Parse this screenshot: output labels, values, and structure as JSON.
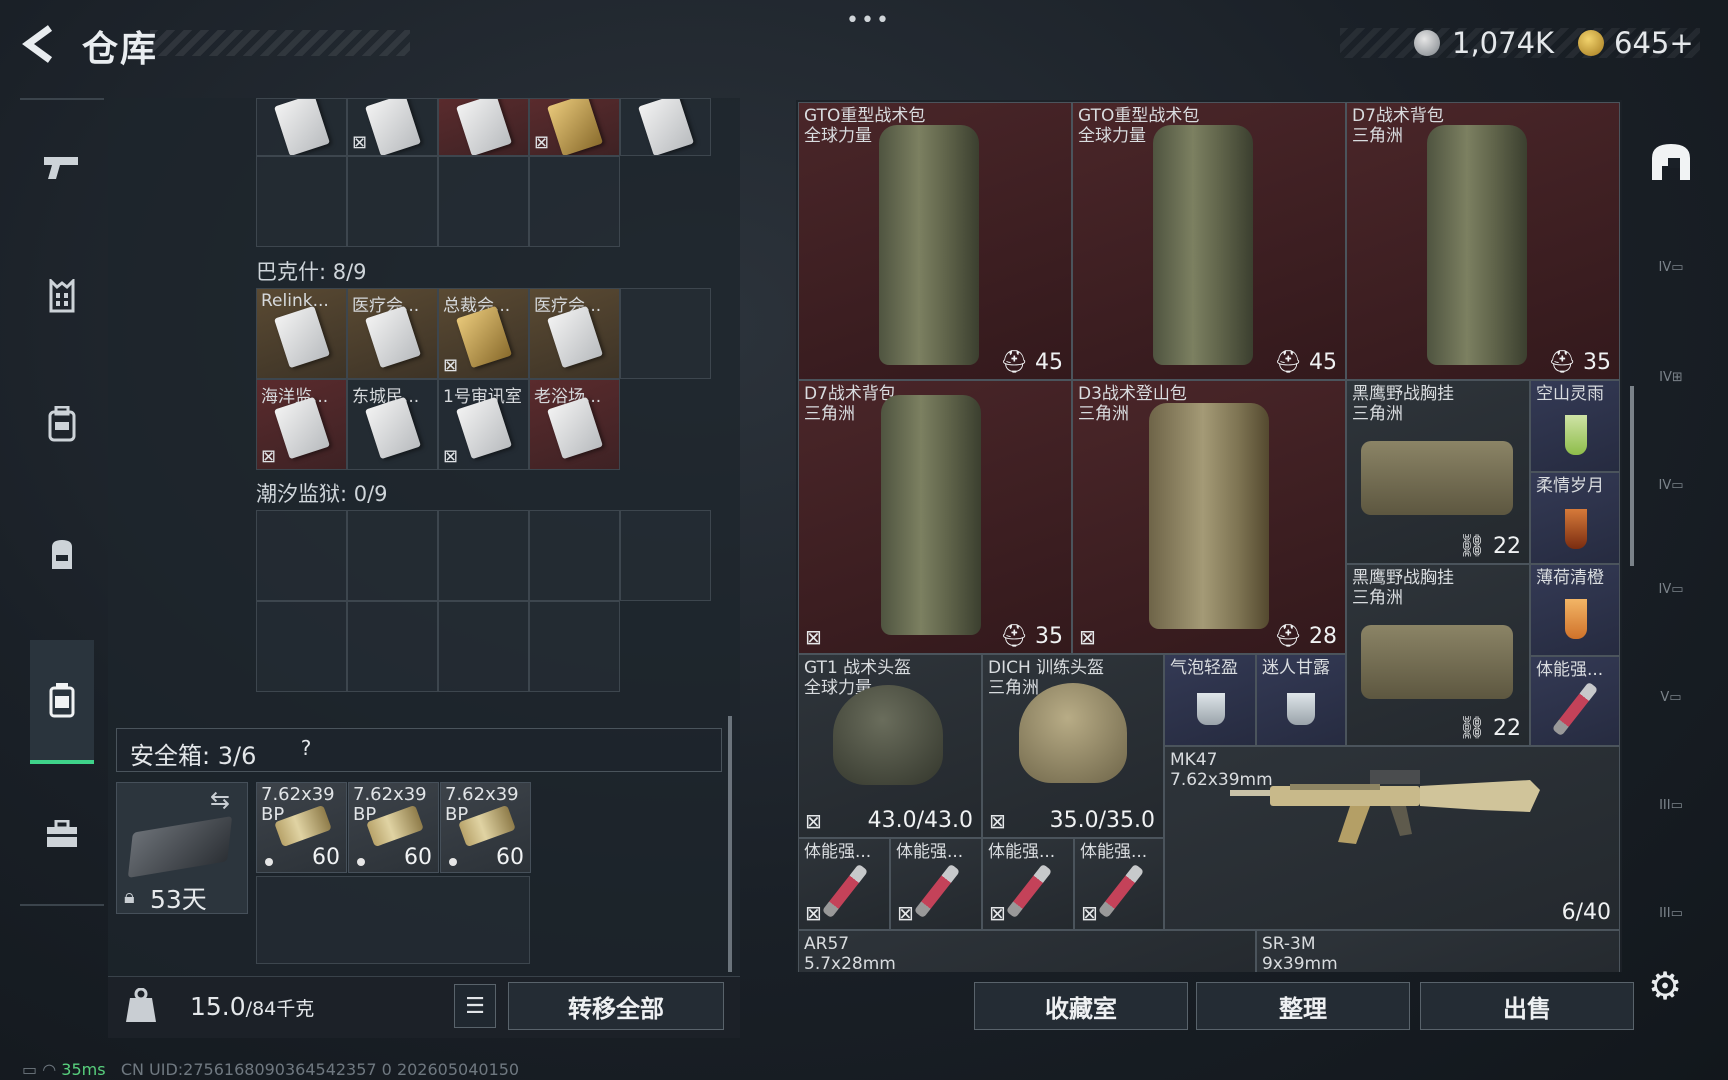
{
  "header": {
    "title": "仓库",
    "menu_dots": "•••",
    "currency_amount": "1,074K",
    "token_amount": "645+"
  },
  "sidebar": {
    "items": [
      {
        "icon": "pistol-icon"
      },
      {
        "icon": "vest-icon"
      },
      {
        "icon": "armor-icon"
      },
      {
        "icon": "backpack-icon"
      },
      {
        "icon": "storage-case-icon",
        "active": true
      },
      {
        "icon": "briefcase-icon"
      }
    ]
  },
  "left_panel": {
    "bakesh_title": "巴克什: 8/9",
    "bakesh_row1": [
      "Relink...",
      "医疗会...",
      "总裁会...",
      "医疗会..."
    ],
    "bakesh_row2": [
      "海洋监...",
      "东城民...",
      "1号审讯室",
      "老浴场..."
    ],
    "tidal_title": "潮汐监狱: 0/9",
    "safe_title": "安全箱: 3/6",
    "safe_help": "?",
    "safe_days": "53天",
    "ammo": [
      {
        "line1": "7.62x39",
        "line2": "BP",
        "count": "60"
      },
      {
        "line1": "7.62x39",
        "line2": "BP",
        "count": "60"
      },
      {
        "line1": "7.62x39",
        "line2": "BP",
        "count": "60"
      }
    ],
    "weight_value": "15.0",
    "weight_total": "/84千克",
    "transfer_all": "转移全部"
  },
  "stash": {
    "tiles": {
      "bp1": {
        "name": "GTO重型战术包",
        "sub": "全球力量",
        "qty": "45"
      },
      "bp2": {
        "name": "GTO重型战术包",
        "sub": "全球力量",
        "qty": "45"
      },
      "bp3": {
        "name": "D7战术背包",
        "sub": "三角洲",
        "qty": "35"
      },
      "bp4": {
        "name": "D7战术背包",
        "sub": "三角洲",
        "qty": "35"
      },
      "bp5": {
        "name": "D3战术登山包",
        "sub": "三角洲",
        "qty": "28"
      },
      "vest1": {
        "name": "黑鹰野战胸挂",
        "sub": "三角洲",
        "qty": "22"
      },
      "vest2": {
        "name": "黑鹰野战胸挂",
        "sub": "三角洲",
        "qty": "22"
      },
      "drink1": {
        "name": "空山灵雨"
      },
      "drink2": {
        "name": "柔情岁月"
      },
      "drink3": {
        "name": "薄荷清橙"
      },
      "syr_side": {
        "name": "体能强..."
      },
      "helm1": {
        "name": "GT1 战术头盔",
        "sub": "全球力量",
        "qty": "43.0/43.0"
      },
      "helm2": {
        "name": "DICH 训练头盔",
        "sub": "三角洲",
        "qty": "35.0/35.0"
      },
      "small1": {
        "name": "气泡轻盈"
      },
      "small2": {
        "name": "迷人甘露"
      },
      "rifle": {
        "name": "MK47",
        "sub": "7.62x39mm",
        "qty": "6/40"
      },
      "syr": [
        "体能强...",
        "体能强...",
        "体能强...",
        "体能强..."
      ],
      "ar57": {
        "name": "AR57",
        "sub": "5.7x28mm"
      },
      "sr3m": {
        "name": "SR-3M",
        "sub": "9x39mm"
      }
    }
  },
  "right_sidebar": {
    "tier_labels": [
      "IV",
      "IV",
      "IV",
      "IV",
      "V",
      "III",
      "III"
    ]
  },
  "buttons": {
    "collection": "收藏室",
    "organize": "整理",
    "sell": "出售"
  },
  "status_bar": {
    "ping": "35ms",
    "uid": "CN UID:2756168090364542357 0 202605040150"
  }
}
